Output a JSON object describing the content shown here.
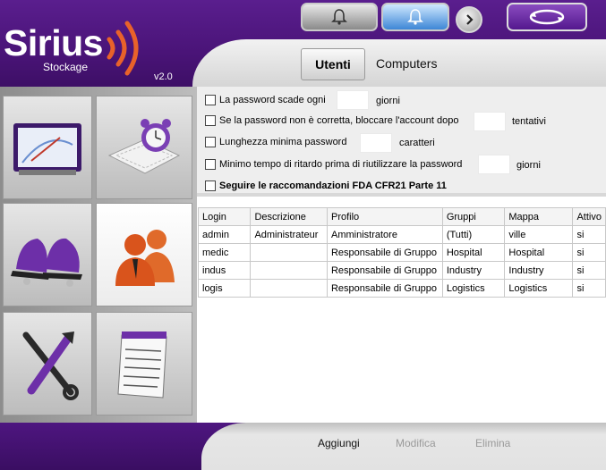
{
  "app": {
    "logo_title": "Sirius",
    "logo_subtitle": "Stockage",
    "version": "v2.0"
  },
  "colors": {
    "brand_purple": "#4a1478",
    "accent_orange": "#e8622a",
    "active_blue": "#3d86d6"
  },
  "top_buttons": [
    {
      "icon": "bell-icon"
    },
    {
      "icon": "bell-icon"
    },
    {
      "icon": "chevron-right-icon"
    },
    {
      "icon": "refresh-icon"
    }
  ],
  "tabs": {
    "utenti": "Utenti",
    "computers": "Computers"
  },
  "sidebar": {
    "tiles": [
      "gauge-icon",
      "alarm-clock-icon",
      "bells-icon",
      "users-icon",
      "tools-icon",
      "notepad-icon"
    ]
  },
  "settings": {
    "password_expiry": {
      "label": "La password scade ogni",
      "value": "",
      "unit": "giorni"
    },
    "lockout": {
      "label": "Se la password non è corretta, bloccare l'account dopo",
      "value": "",
      "unit": "tentativi"
    },
    "min_length": {
      "label": "Lunghezza minima password",
      "value": "",
      "unit": "caratteri"
    },
    "reuse_delay": {
      "label": "Minimo tempo di ritardo prima di riutilizzare la password",
      "value": "",
      "unit": "giorni"
    },
    "fda": {
      "label": "Seguire le raccomandazioni FDA CFR21 Parte 11"
    }
  },
  "users_table": {
    "columns": [
      "Login",
      "Descrizione",
      "Profilo",
      "Gruppi",
      "Mappa",
      "Attivo"
    ],
    "rows": [
      [
        "admin",
        "Administrateur",
        "Amministratore",
        "(Tutti)",
        "ville",
        "si"
      ],
      [
        "medic",
        "",
        "Responsabile di Gruppo",
        "Hospital",
        "Hospital",
        "si"
      ],
      [
        "indus",
        "",
        "Responsabile di Gruppo",
        "Industry",
        "Industry",
        "si"
      ],
      [
        "logis",
        "",
        "Responsabile di Gruppo",
        "Logistics",
        "Logistics",
        "si"
      ]
    ]
  },
  "footer": {
    "add": "Aggiungi",
    "edit": "Modifica",
    "delete": "Elimina"
  }
}
